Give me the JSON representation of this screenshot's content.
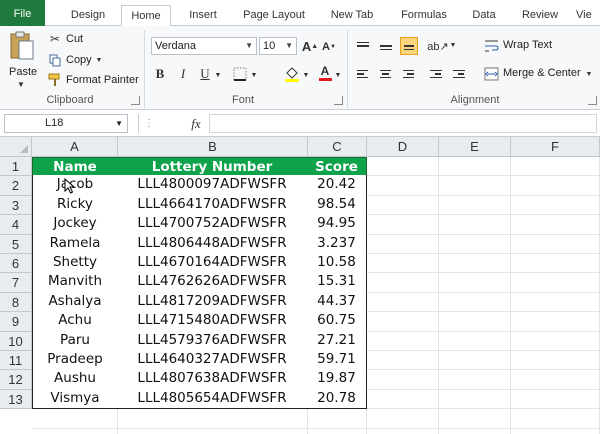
{
  "tabs": [
    "File",
    "Design",
    "Home",
    "Insert",
    "Page Layout",
    "New Tab",
    "Formulas",
    "Data",
    "Review",
    "Vie"
  ],
  "active_tab": "Home",
  "clipboard": {
    "paste": "Paste",
    "cut": "Cut",
    "copy": "Copy",
    "format_painter": "Format Painter",
    "group": "Clipboard"
  },
  "font": {
    "name": "Verdana",
    "size": "10",
    "group": "Font"
  },
  "alignment": {
    "wrap_text": "Wrap Text",
    "merge_center": "Merge & Center",
    "group": "Alignment"
  },
  "formula_bar": {
    "name_box": "L18",
    "fx": "fx",
    "formula": ""
  },
  "sheet": {
    "columns": [
      "A",
      "B",
      "C",
      "D",
      "E",
      "F"
    ],
    "rows": [
      "1",
      "2",
      "3",
      "4",
      "5",
      "6",
      "7",
      "8",
      "9",
      "10",
      "11",
      "12",
      "13"
    ],
    "headers": [
      "Name",
      "Lottery Number",
      "Score"
    ],
    "data": [
      [
        "Jacob",
        "LLL4800097ADFWSFR",
        "20.42"
      ],
      [
        "Ricky",
        "LLL4664170ADFWSFR",
        "98.54"
      ],
      [
        "Jockey",
        "LLL4700752ADFWSFR",
        "94.95"
      ],
      [
        "Ramela",
        "LLL4806448ADFWSFR",
        "3.237"
      ],
      [
        "Shetty",
        "LLL4670164ADFWSFR",
        "10.58"
      ],
      [
        "Manvith",
        "LLL4762626ADFWSFR",
        "15.31"
      ],
      [
        "Ashalya",
        "LLL4817209ADFWSFR",
        "44.37"
      ],
      [
        "Achu",
        "LLL4715480ADFWSFR",
        "60.75"
      ],
      [
        "Paru",
        "LLL4579376ADFWSFR",
        "27.21"
      ],
      [
        "Pradeep",
        "LLL4640327ADFWSFR",
        "59.71"
      ],
      [
        "Aushu",
        "LLL4807638ADFWSFR",
        "19.87"
      ],
      [
        "Vismya",
        "LLL4805654ADFWSFR",
        "20.78"
      ]
    ]
  },
  "colors": {
    "file_tab": "#1f7a3e",
    "header_fill": "#0ea24b",
    "header_text": "#ffffff"
  }
}
